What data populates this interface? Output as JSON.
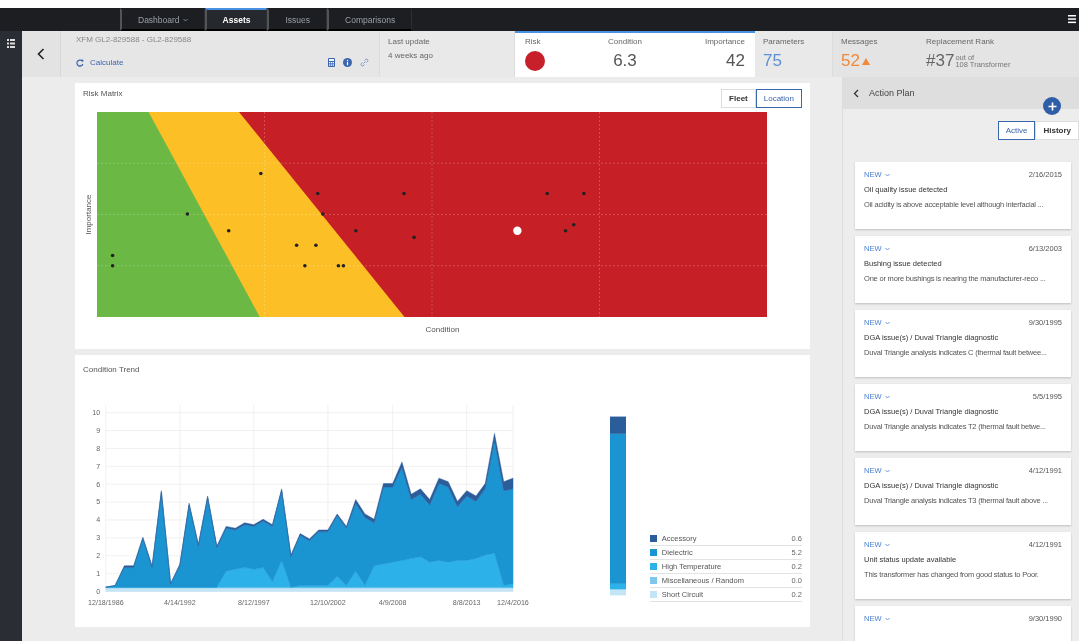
{
  "nav": {
    "tabs": [
      {
        "label": "Dashboard",
        "dropdown": true,
        "selected": false
      },
      {
        "label": "Assets",
        "dropdown": false,
        "selected": true
      },
      {
        "label": "Issues",
        "dropdown": false,
        "selected": false
      },
      {
        "label": "Comparisons",
        "dropdown": false,
        "selected": false
      }
    ]
  },
  "header": {
    "asset_id": "XFM GL2-829588 - GL2-829588",
    "calculate": "Calculate",
    "last_update": {
      "label": "Last update",
      "value": "4 weeks ago"
    },
    "risk": {
      "label": "Risk",
      "color": "#c8202a"
    },
    "condition": {
      "label": "Condition",
      "value": "6.3"
    },
    "importance": {
      "label": "Importance",
      "value": "42"
    },
    "parameters": {
      "label": "Parameters",
      "value": "75"
    },
    "messages": {
      "label": "Messages",
      "value": "52",
      "warning": true
    },
    "rank": {
      "label": "Replacement Rank",
      "value": "#37",
      "out_of": "out of",
      "total": "108 Transformer"
    }
  },
  "risk_matrix": {
    "title": "Risk Matrix",
    "toggle": [
      {
        "label": "Fleet",
        "selected": false
      },
      {
        "label": "Location",
        "selected": true
      }
    ],
    "xlabel": "Condition",
    "ylabel": "Importance"
  },
  "condition_trend": {
    "title": "Condition Trend",
    "chart_data": {
      "type": "area",
      "stacked": true,
      "grid": true,
      "ylim": [
        0,
        10
      ],
      "yticks": [
        0,
        1,
        2,
        3,
        4,
        5,
        6,
        7,
        8,
        9,
        10
      ],
      "categories": [
        "12/18/1986",
        null,
        null,
        null,
        null,
        null,
        null,
        null,
        "4/14/1992",
        null,
        null,
        null,
        null,
        null,
        null,
        null,
        "8/12/1997",
        null,
        null,
        null,
        null,
        null,
        null,
        null,
        "12/10/2002",
        null,
        null,
        null,
        null,
        null,
        null,
        "4/9/2008",
        null,
        null,
        null,
        null,
        null,
        null,
        null,
        "8/8/2013",
        null,
        null,
        null,
        null,
        "12/4/2016"
      ],
      "series": [
        {
          "name": "Short Circuit",
          "color": "#c3e5f6",
          "values": [
            0.2,
            0.2,
            0.2,
            0.2,
            0.2,
            0.2,
            0.2,
            0.2,
            0.2,
            0.2,
            0.2,
            0.2,
            0.2,
            0.2,
            0.2,
            0.2,
            0.2,
            0.2,
            0.2,
            0.2,
            0.2,
            0.2,
            0.2,
            0.2,
            0.2,
            0.2,
            0.2,
            0.2,
            0.2,
            0.2,
            0.2,
            0.2,
            0.2,
            0.2,
            0.2,
            0.2,
            0.2,
            0.2,
            0.2,
            0.2,
            0.2,
            0.2,
            0.2,
            0.2,
            0.2
          ]
        },
        {
          "name": "Miscellaneous / Random",
          "color": "#7fc6ea",
          "values": [
            0.04,
            0.04,
            0.04,
            0.04,
            0.04,
            0.04,
            0.04,
            0.04,
            0.04,
            0.04,
            0.04,
            0.04,
            0.04,
            0.04,
            0.04,
            0.04,
            0.04,
            0.04,
            0.04,
            0.04,
            0.04,
            0.04,
            0.04,
            0.04,
            0.04,
            0.04,
            0.04,
            0.04,
            0.04,
            0.04,
            0.04,
            0.04,
            0.04,
            0.04,
            0.04,
            0.04,
            0.04,
            0.04,
            0.04,
            0.04,
            0.04,
            0.04,
            0.04,
            0.04,
            0.04
          ]
        },
        {
          "name": "High Temperature",
          "color": "#2cb2e8",
          "values": [
            0,
            0,
            0,
            0,
            0,
            0,
            0,
            0,
            0,
            0,
            0,
            0,
            0,
            0.9,
            1.0,
            1.1,
            1.0,
            1.1,
            0.3,
            1.5,
            0,
            0.1,
            0.1,
            0.1,
            0.1,
            0.6,
            0.1,
            0.9,
            0.1,
            1.2,
            1.3,
            1.4,
            1.5,
            1.6,
            1.7,
            1.4,
            1.5,
            1.4,
            1.5,
            1.5,
            1.6,
            1.8,
            1.9,
            0.1,
            0.2
          ]
        },
        {
          "name": "Dielectric",
          "color": "#1b94d2",
          "values": [
            0,
            0.1,
            1.1,
            1.1,
            2.7,
            1.1,
            5.3,
            0.2,
            1.2,
            4.6,
            2.3,
            5.0,
            2.2,
            2.4,
            2.2,
            2.4,
            2.4,
            2.6,
            3.1,
            3.9,
            1.7,
            2.8,
            2.5,
            3.0,
            3.0,
            3.4,
            3.2,
            3.8,
            3.8,
            2.4,
            4.3,
            4.2,
            5.2,
            3.3,
            3.5,
            3.2,
            4.3,
            4.2,
            3.0,
            3.6,
            3.2,
            3.7,
            6.3,
            5.3,
            5.3
          ]
        },
        {
          "name": "Accessory",
          "color": "#2b5d9b",
          "values": [
            0,
            0,
            0.1,
            0.1,
            0.1,
            0.1,
            0.1,
            0,
            0.1,
            0.1,
            0.1,
            0.1,
            0.1,
            0.1,
            0.1,
            0.1,
            0.1,
            0.1,
            0.1,
            0.1,
            0.1,
            0.1,
            0.1,
            0.1,
            0.1,
            0.1,
            0.1,
            0.2,
            0.2,
            0.2,
            0.2,
            0.2,
            0.3,
            0.3,
            0.3,
            0.3,
            0.3,
            0.3,
            0.3,
            0.3,
            0.3,
            0.3,
            0.4,
            0.5,
            0.6
          ]
        }
      ]
    },
    "legend_values": [
      "0.6",
      "5.2",
      "0.2",
      "0.0",
      "0.2"
    ]
  },
  "action_plan": {
    "title": "Action Plan",
    "toggle": [
      {
        "label": "Active",
        "selected": true
      },
      {
        "label": "History",
        "selected": false
      }
    ],
    "items": [
      {
        "status": "NEW",
        "date": "2/16/2015",
        "title": "Oil quality issue detected",
        "description": "Oil acidity is above acceptable level although interfacial ..."
      },
      {
        "status": "NEW",
        "date": "6/13/2003",
        "title": "Bushing issue detected",
        "description": "One or more bushings is nearing the manufacturer-reco ..."
      },
      {
        "status": "NEW",
        "date": "9/30/1995",
        "title": "DGA issue(s) / Duval Triangle diagnostic",
        "description": "Duval Triangle analysis indicates C (thermal fault betwee..."
      },
      {
        "status": "NEW",
        "date": "5/5/1995",
        "title": "DGA issue(s) / Duval Triangle diagnostic",
        "description": "Duval Triangle analysis indicates T2 (thermal fault betwe..."
      },
      {
        "status": "NEW",
        "date": "4/12/1991",
        "title": "DGA issue(s) / Duval Triangle diagnostic",
        "description": "Duval Triangle analysis indicates T3 (thermal fault above ..."
      },
      {
        "status": "NEW",
        "date": "4/12/1991",
        "title": "Unit status update available",
        "description": "This transformer has changed from good status to Poor."
      },
      {
        "status": "NEW",
        "date": "9/30/1990"
      }
    ]
  }
}
